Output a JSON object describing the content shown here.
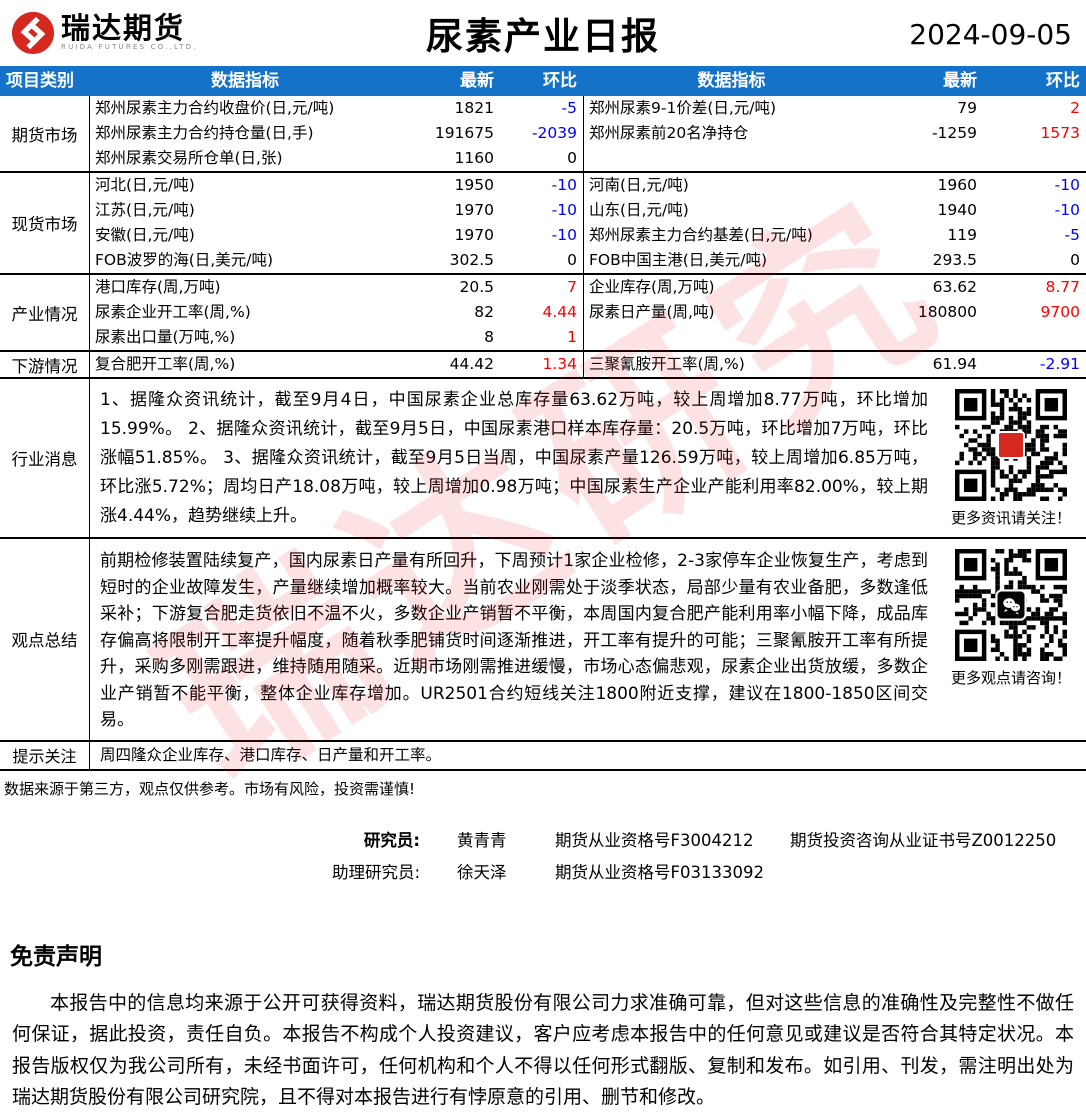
{
  "header": {
    "logo_text": "瑞达期货",
    "logo_subtext": "RUIDA FUTURES CO.,LTD.",
    "title": "尿素产业日报",
    "date": "2024-09-05"
  },
  "colors": {
    "header_blue": "#1472c8",
    "up_red": "#fe0000",
    "down_blue": "#0000fe"
  },
  "watermark": "瑞达研究",
  "table": {
    "columns": [
      "项目类别",
      "数据指标",
      "最新",
      "环比",
      "数据指标",
      "最新",
      "环比"
    ],
    "sections": [
      {
        "category": "期货市场",
        "rows": [
          {
            "l_label": "郑州尿素主力合约收盘价(日,元/吨)",
            "l_latest": "1821",
            "l_change": "-5",
            "l_dir": "down",
            "r_label": "郑州尿素9-1价差(日,元/吨)",
            "r_latest": "79",
            "r_change": "2",
            "r_dir": "up"
          },
          {
            "l_label": "郑州尿素主力合约持仓量(日,手)",
            "l_latest": "191675",
            "l_change": "-2039",
            "l_dir": "down",
            "r_label": "郑州尿素前20名净持仓",
            "r_latest": "-1259",
            "r_change": "1573",
            "r_dir": "up"
          },
          {
            "l_label": "郑州尿素交易所仓单(日,张)",
            "l_latest": "1160",
            "l_change": "0",
            "l_dir": "flat",
            "r_label": "",
            "r_latest": "",
            "r_change": "",
            "r_dir": "flat"
          }
        ]
      },
      {
        "category": "现货市场",
        "rows": [
          {
            "l_label": "河北(日,元/吨)",
            "l_latest": "1950",
            "l_change": "-10",
            "l_dir": "down",
            "r_label": "河南(日,元/吨)",
            "r_latest": "1960",
            "r_change": "-10",
            "r_dir": "down"
          },
          {
            "l_label": "江苏(日,元/吨)",
            "l_latest": "1970",
            "l_change": "-10",
            "l_dir": "down",
            "r_label": "山东(日,元/吨)",
            "r_latest": "1940",
            "r_change": "-10",
            "r_dir": "down"
          },
          {
            "l_label": "安徽(日,元/吨)",
            "l_latest": "1970",
            "l_change": "-10",
            "l_dir": "down",
            "r_label": "郑州尿素主力合约基差(日,元/吨)",
            "r_latest": "119",
            "r_change": "-5",
            "r_dir": "down"
          },
          {
            "l_label": "FOB波罗的海(日,美元/吨)",
            "l_latest": "302.5",
            "l_change": "0",
            "l_dir": "flat",
            "r_label": "FOB中国主港(日,美元/吨)",
            "r_latest": "293.5",
            "r_change": "0",
            "r_dir": "flat"
          }
        ]
      },
      {
        "category": "产业情况",
        "rows": [
          {
            "l_label": "港口库存(周,万吨)",
            "l_latest": "20.5",
            "l_change": "7",
            "l_dir": "up",
            "r_label": "企业库存(周,万吨)",
            "r_latest": "63.62",
            "r_change": "8.77",
            "r_dir": "up"
          },
          {
            "l_label": "尿素企业开工率(周,%)",
            "l_latest": "82",
            "l_change": "4.44",
            "l_dir": "up",
            "r_label": "尿素日产量(周,吨)",
            "r_latest": "180800",
            "r_change": "9700",
            "r_dir": "up"
          },
          {
            "l_label": "尿素出口量(万吨,%)",
            "l_latest": "8",
            "l_change": "1",
            "l_dir": "up",
            "r_label": "",
            "r_latest": "",
            "r_change": "",
            "r_dir": "flat"
          }
        ]
      },
      {
        "category": "下游情况",
        "rows": [
          {
            "l_label": "复合肥开工率(周,%)",
            "l_latest": "44.42",
            "l_change": "1.34",
            "l_dir": "up",
            "r_label": "三聚氰胺开工率(周,%)",
            "r_latest": "61.94",
            "r_change": "-2.91",
            "r_dir": "down"
          }
        ]
      }
    ]
  },
  "news": {
    "category": "行业消息",
    "text": "1、据隆众资讯统计，截至9月4日，中国尿素企业总库存量63.62万吨，较上周增加8.77万吨，环比增加15.99%。 2、据隆众资讯统计，截至9月5日，中国尿素港口样本库存量：20.5万吨，环比增加7万吨，环比涨幅51.85%。 3、据隆众资讯统计，截至9月5日当周，中国尿素产量126.59万吨，较上周增加6.85万吨，环比涨5.72%；周均日产18.08万吨，较上周增加0.98万吨；中国尿素生产企业产能利用率82.00%，较上期涨4.44%，趋势继续上升。",
    "qr_caption": "更多资讯请关注！"
  },
  "summary": {
    "category": "观点总结",
    "text": "前期检修装置陆续复产，国内尿素日产量有所回升，下周预计1家企业检修，2-3家停车企业恢复生产，考虑到短时的企业故障发生，产量继续增加概率较大。当前农业刚需处于淡季状态，局部少量有农业备肥，多数逢低采补；下游复合肥走货依旧不温不火，多数企业产销暂不平衡，本周国内复合肥产能利用率小幅下降，成品库存偏高将限制开工率提升幅度，随着秋季肥铺货时间逐渐推进，开工率有提升的可能；三聚氰胺开工率有所提升，采购多刚需跟进，维持随用随采。近期市场刚需推进缓慢，市场心态偏悲观，尿素企业出货放缓，多数企业产销暂不能平衡，整体企业库存增加。UR2501合约短线关注1800附近支撑，建议在1800-1850区间交易。",
    "qr_caption": "更多观点请咨询！"
  },
  "tips": {
    "category": "提示关注",
    "text": "周四隆众企业库存、港口库存、日产量和开工率。"
  },
  "footer_note": "数据来源于第三方，观点仅供参考。市场有风险，投资需谨慎!",
  "researchers": [
    {
      "role": "研究员:",
      "name": "黄青青",
      "cert1": "期货从业资格号F3004212",
      "cert2": "期货投资咨询从业证书号Z0012250"
    },
    {
      "role": "助理研究员:",
      "name": "徐天泽",
      "cert1": "期货从业资格号F03133092",
      "cert2": ""
    }
  ],
  "disclaimer": {
    "title": "免责声明",
    "body": "本报告中的信息均来源于公开可获得资料，瑞达期货股份有限公司力求准确可靠，但对这些信息的准确性及完整性不做任何保证，据此投资，责任自负。本报告不构成个人投资建议，客户应考虑本报告中的任何意见或建议是否符合其特定状况。本报告版权仅为我公司所有，未经书面许可，任何机构和个人不得以任何形式翻版、复制和发布。如引用、刊发，需注明出处为瑞达期货股份有限公司研究院，且不得对本报告进行有悖原意的引用、删节和修改。"
  }
}
